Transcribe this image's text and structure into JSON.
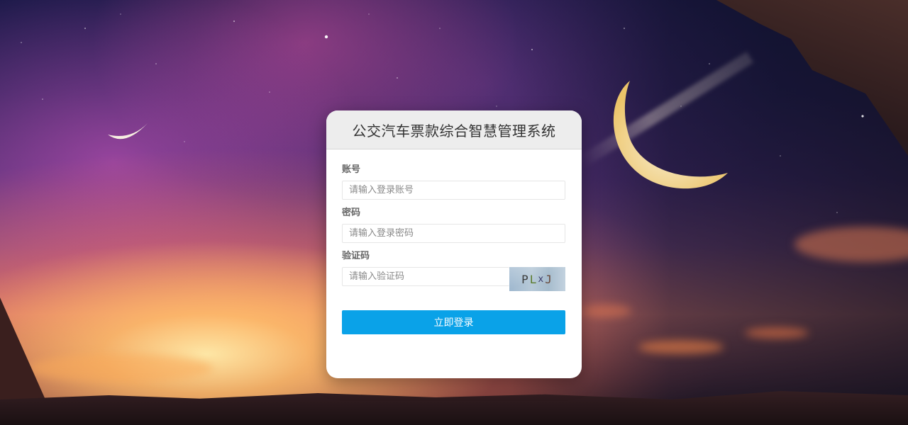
{
  "login": {
    "title": "公交汽车票款综合智慧管理系统",
    "account_label": "账号",
    "account_placeholder": "请输入登录账号",
    "account_value": "",
    "password_label": "密码",
    "password_placeholder": "请输入登录密码",
    "password_value": "",
    "captcha_label": "验证码",
    "captcha_placeholder": "请输入验证码",
    "captcha_value": "",
    "captcha_text": [
      "P",
      "L",
      "x",
      "J"
    ],
    "submit_label": "立即登录"
  },
  "colors": {
    "primary_button": "#0aa2e8",
    "header_bg": "#ededed"
  }
}
